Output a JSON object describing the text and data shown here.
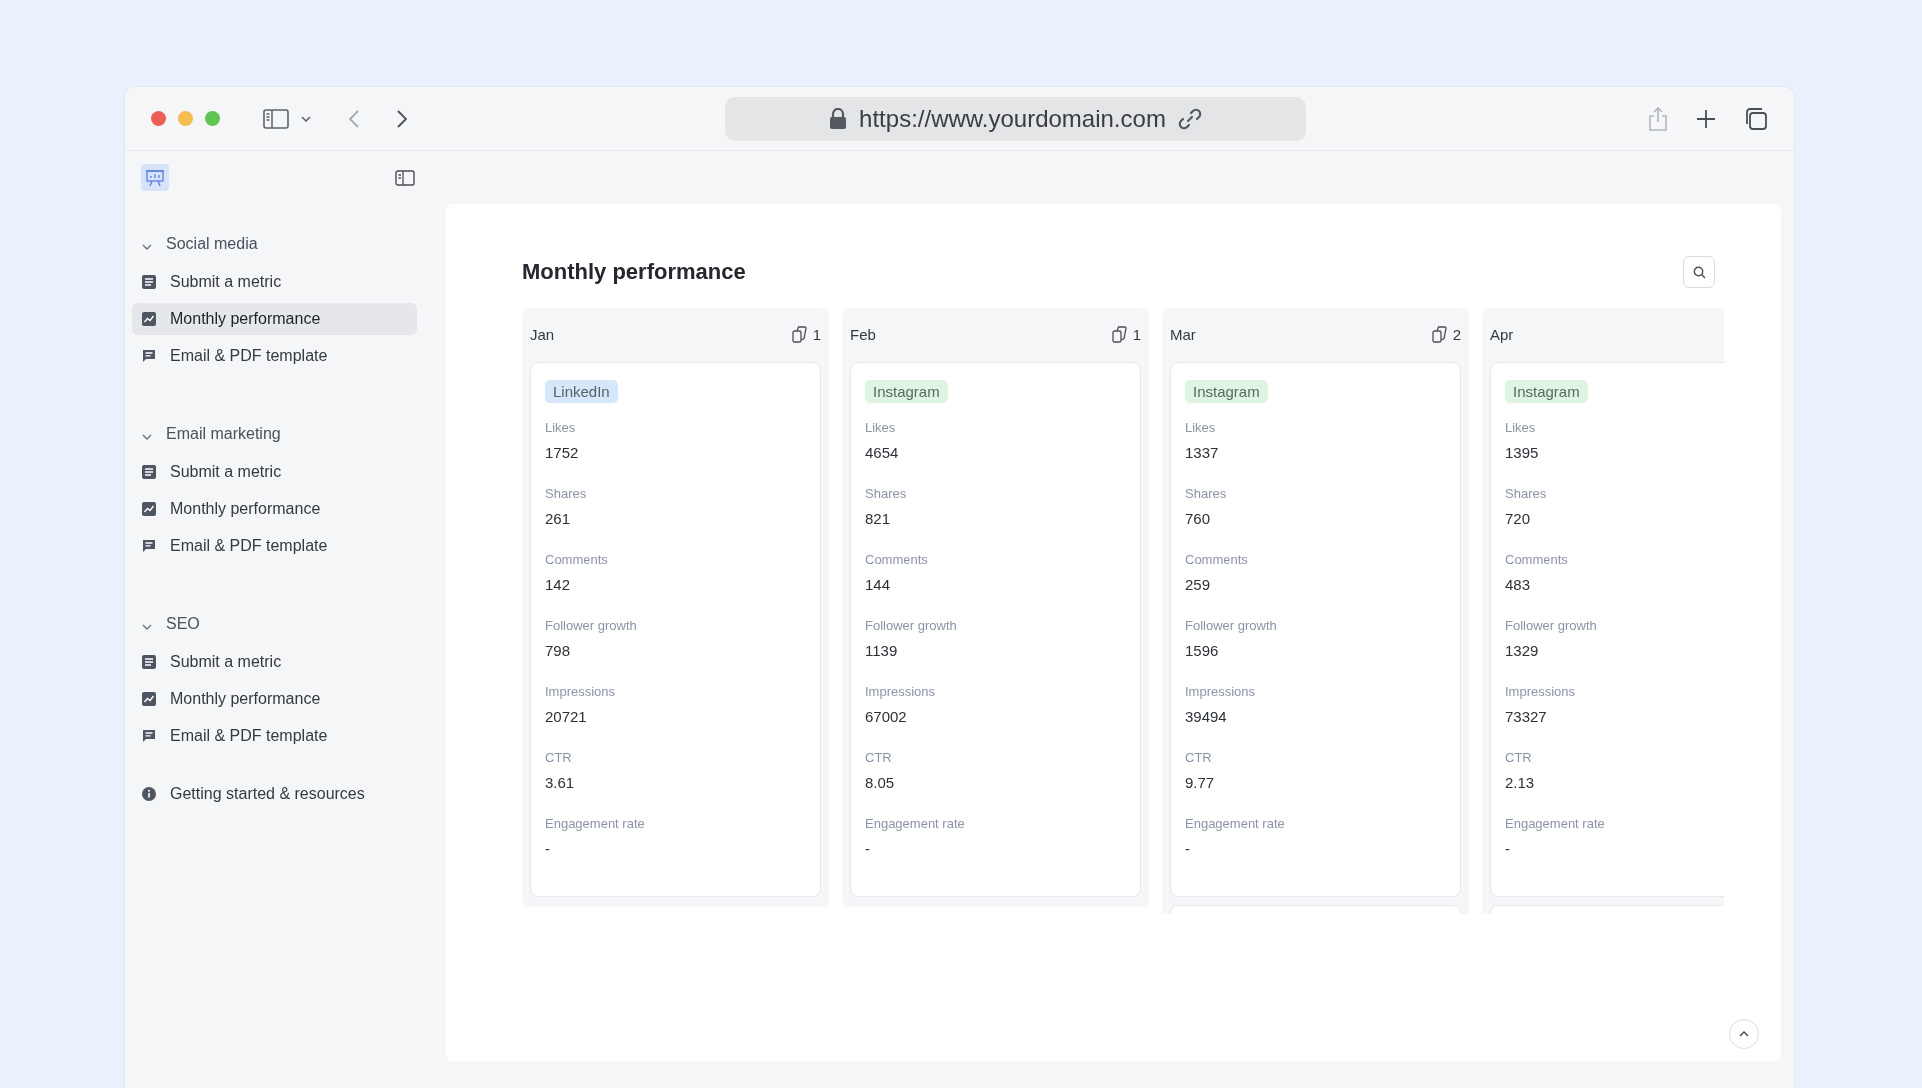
{
  "browser": {
    "url": "https://www.yourdomain.com"
  },
  "sidebar": {
    "groups": [
      {
        "title": "Social media",
        "expanded": true,
        "items": [
          {
            "label": "Submit a metric",
            "kind": "form",
            "selected": false
          },
          {
            "label": "Monthly performance",
            "kind": "chart",
            "selected": true
          },
          {
            "label": "Email & PDF template",
            "kind": "message",
            "selected": false
          }
        ]
      },
      {
        "title": "Email marketing",
        "expanded": true,
        "items": [
          {
            "label": "Submit a metric",
            "kind": "form",
            "selected": false
          },
          {
            "label": "Monthly performance",
            "kind": "chart",
            "selected": false
          },
          {
            "label": "Email & PDF template",
            "kind": "message",
            "selected": false
          }
        ]
      },
      {
        "title": "SEO",
        "expanded": true,
        "items": [
          {
            "label": "Submit a metric",
            "kind": "form",
            "selected": false
          },
          {
            "label": "Monthly performance",
            "kind": "chart",
            "selected": false
          },
          {
            "label": "Email & PDF template",
            "kind": "message",
            "selected": false
          }
        ]
      }
    ],
    "footer_items": [
      {
        "label": "Getting started & resources",
        "kind": "info",
        "selected": false
      }
    ]
  },
  "page": {
    "title": "Monthly performance",
    "columns": [
      {
        "title": "Jan",
        "count": "1",
        "more_below": false,
        "cards": [
          {
            "tag": {
              "label": "LinkedIn",
              "color": "#d6e6fb"
            },
            "fields": [
              {
                "label": "Likes",
                "value": "1752"
              },
              {
                "label": "Shares",
                "value": "261"
              },
              {
                "label": "Comments",
                "value": "142"
              },
              {
                "label": "Follower growth",
                "value": "798"
              },
              {
                "label": "Impressions",
                "value": "20721"
              },
              {
                "label": "CTR",
                "value": "3.61"
              },
              {
                "label": "Engagement rate",
                "value": "-"
              }
            ]
          }
        ]
      },
      {
        "title": "Feb",
        "count": "1",
        "more_below": false,
        "cards": [
          {
            "tag": {
              "label": "Instagram",
              "color": "#dff5e3"
            },
            "fields": [
              {
                "label": "Likes",
                "value": "4654"
              },
              {
                "label": "Shares",
                "value": "821"
              },
              {
                "label": "Comments",
                "value": "144"
              },
              {
                "label": "Follower growth",
                "value": "1139"
              },
              {
                "label": "Impressions",
                "value": "67002"
              },
              {
                "label": "CTR",
                "value": "8.05"
              },
              {
                "label": "Engagement rate",
                "value": "-"
              }
            ]
          }
        ]
      },
      {
        "title": "Mar",
        "count": "2",
        "more_below": true,
        "cards": [
          {
            "tag": {
              "label": "Instagram",
              "color": "#dff5e3"
            },
            "fields": [
              {
                "label": "Likes",
                "value": "1337"
              },
              {
                "label": "Shares",
                "value": "760"
              },
              {
                "label": "Comments",
                "value": "259"
              },
              {
                "label": "Follower growth",
                "value": "1596"
              },
              {
                "label": "Impressions",
                "value": "39494"
              },
              {
                "label": "CTR",
                "value": "9.77"
              },
              {
                "label": "Engagement rate",
                "value": "-"
              }
            ]
          }
        ]
      },
      {
        "title": "Apr",
        "more_below": true,
        "cards": [
          {
            "tag": {
              "label": "Instagram",
              "color": "#dff5e3"
            },
            "fields": [
              {
                "label": "Likes",
                "value": "1395"
              },
              {
                "label": "Shares",
                "value": "720"
              },
              {
                "label": "Comments",
                "value": "483"
              },
              {
                "label": "Follower growth",
                "value": "1329"
              },
              {
                "label": "Impressions",
                "value": "73327"
              },
              {
                "label": "CTR",
                "value": "2.13"
              },
              {
                "label": "Engagement rate",
                "value": "-"
              }
            ]
          }
        ]
      }
    ]
  }
}
